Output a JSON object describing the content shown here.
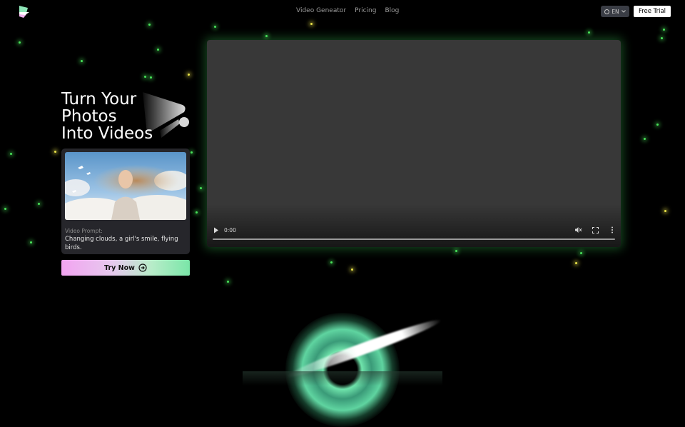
{
  "header": {
    "logo_icon": "brand-logo-icon",
    "nav": [
      {
        "label": "Video Geneator"
      },
      {
        "label": "Pricing"
      },
      {
        "label": "Blog"
      }
    ],
    "language": {
      "label": "EN",
      "icon": "globe-icon"
    },
    "free_trial_label": "Free Trial"
  },
  "hero": {
    "title_lines": [
      "Turn Your",
      "Photos",
      "Into Videos"
    ]
  },
  "example_card": {
    "image_alt": "girl with flowing hair in clouds with birds",
    "prompt_label": "Video Prompt:",
    "prompt_text": "Changing clouds, a girl's smile, flying birds."
  },
  "cta": {
    "label": "Try Now",
    "icon": "arrow-right-circle-icon"
  },
  "video_player": {
    "time": "0:00",
    "controls": [
      "play-icon",
      "mute-icon",
      "fullscreen-icon",
      "more-options-icon"
    ]
  },
  "colors": {
    "accent_green": "#49e35a",
    "cta_gradient_start": "#f2a4f0",
    "cta_gradient_end": "#7ae6a8",
    "video_bg": "#383838",
    "card_bg": "#26262b"
  }
}
